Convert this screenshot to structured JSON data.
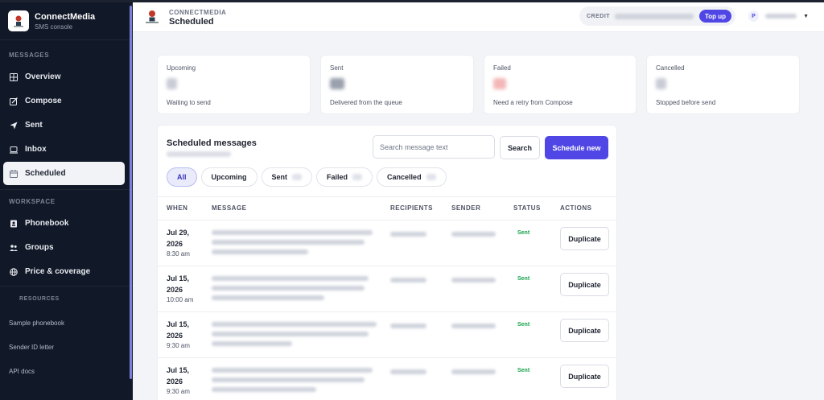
{
  "brand": {
    "name": "ConnectMedia",
    "subtitle": "SMS console"
  },
  "sidebar": {
    "sections": {
      "messages": "MESSAGES",
      "workspace": "WORKSPACE",
      "resources": "RESOURCES"
    },
    "messages_items": [
      {
        "label": "Overview",
        "icon": "grid-icon"
      },
      {
        "label": "Compose",
        "icon": "edit-icon"
      },
      {
        "label": "Sent",
        "icon": "send-icon"
      },
      {
        "label": "Inbox",
        "icon": "inbox-icon"
      },
      {
        "label": "Scheduled",
        "icon": "calendar-icon",
        "active": true
      }
    ],
    "workspace_items": [
      {
        "label": "Phonebook",
        "icon": "phonebook-icon"
      },
      {
        "label": "Groups",
        "icon": "users-icon"
      },
      {
        "label": "Price & coverage",
        "icon": "globe-icon"
      }
    ],
    "resource_links": [
      "Sample phonebook",
      "Sender ID letter",
      "API docs"
    ]
  },
  "topbar": {
    "overline": "CONNECTMEDIA",
    "title": "Scheduled",
    "credit_label": "CREDIT",
    "topup_label": "Top up",
    "avatar_initial": "P"
  },
  "stats": [
    {
      "label": "Upcoming",
      "sub": "Waiting to send"
    },
    {
      "label": "Sent",
      "sub": "Delivered from the queue"
    },
    {
      "label": "Failed",
      "sub": "Need a retry from Compose"
    },
    {
      "label": "Cancelled",
      "sub": "Stopped before send"
    }
  ],
  "panel": {
    "title": "Scheduled messages",
    "search_placeholder": "Search message text",
    "search_label": "Search",
    "schedule_label": "Schedule new",
    "filters": [
      "All",
      "Upcoming",
      "Sent",
      "Failed",
      "Cancelled"
    ],
    "columns": [
      "WHEN",
      "MESSAGE",
      "RECIPIENTS",
      "SENDER",
      "STATUS",
      "ACTIONS"
    ],
    "rows": [
      {
        "date": "Jul 29, 2026",
        "time": "8:30 am",
        "status": "Sent",
        "action": "Duplicate"
      },
      {
        "date": "Jul 15, 2026",
        "time": "10:00 am",
        "status": "Sent",
        "action": "Duplicate"
      },
      {
        "date": "Jul 15, 2026",
        "time": "9:30 am",
        "status": "Sent",
        "action": "Duplicate"
      },
      {
        "date": "Jul 15, 2026",
        "time": "9:30 am",
        "status": "Sent",
        "action": "Duplicate"
      }
    ]
  },
  "colors": {
    "accent": "#4f46e5",
    "sidebar": "#111827",
    "success": "#16a34a"
  }
}
